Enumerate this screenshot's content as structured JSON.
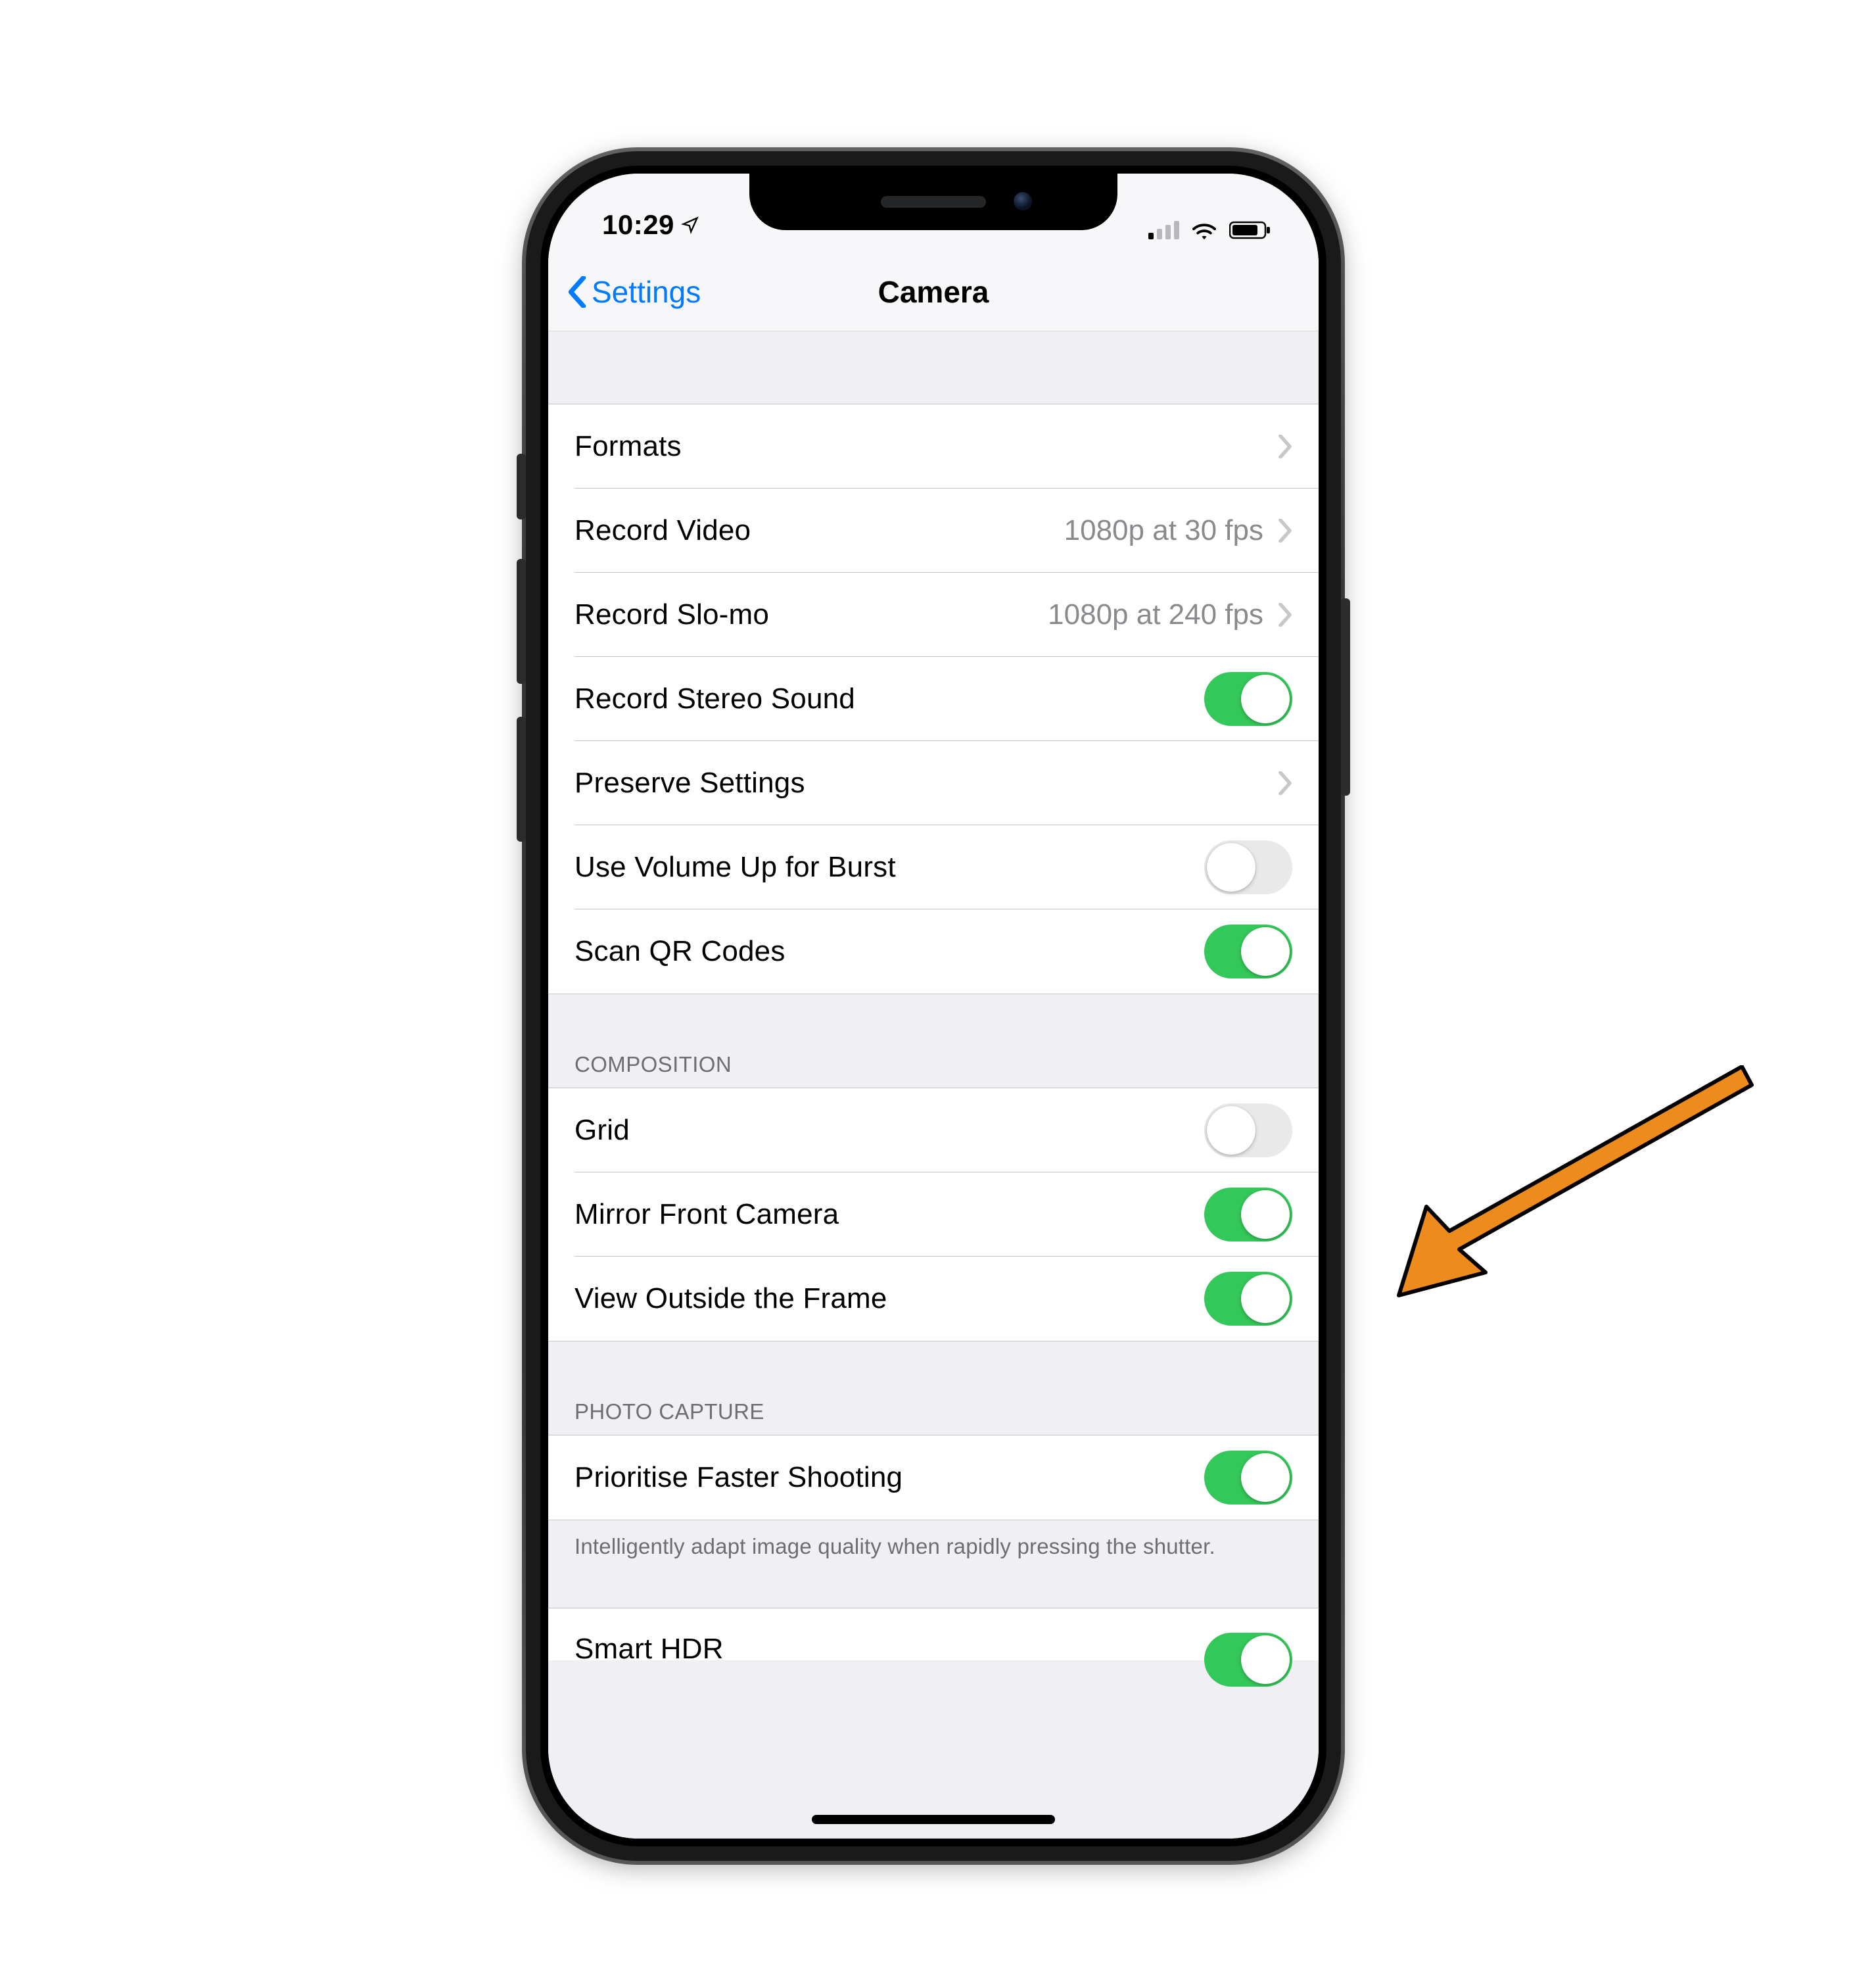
{
  "status": {
    "time": "10:29"
  },
  "nav": {
    "back": "Settings",
    "title": "Camera"
  },
  "groups": [
    {
      "header": "",
      "rows": [
        {
          "label": "Formats",
          "type": "disclosure",
          "detail": ""
        },
        {
          "label": "Record Video",
          "type": "disclosure",
          "detail": "1080p at 30 fps"
        },
        {
          "label": "Record Slo-mo",
          "type": "disclosure",
          "detail": "1080p at 240 fps"
        },
        {
          "label": "Record Stereo Sound",
          "type": "toggle",
          "on": true
        },
        {
          "label": "Preserve Settings",
          "type": "disclosure",
          "detail": ""
        },
        {
          "label": "Use Volume Up for Burst",
          "type": "toggle",
          "on": false
        },
        {
          "label": "Scan QR Codes",
          "type": "toggle",
          "on": true
        }
      ]
    },
    {
      "header": "COMPOSITION",
      "rows": [
        {
          "label": "Grid",
          "type": "toggle",
          "on": false
        },
        {
          "label": "Mirror Front Camera",
          "type": "toggle",
          "on": true
        },
        {
          "label": "View Outside the Frame",
          "type": "toggle",
          "on": true
        }
      ]
    },
    {
      "header": "PHOTO CAPTURE",
      "rows": [
        {
          "label": "Prioritise Faster Shooting",
          "type": "toggle",
          "on": true
        }
      ],
      "footer": "Intelligently adapt image quality when rapidly pressing the shutter."
    }
  ],
  "partial_row": {
    "label": "Smart HDR",
    "on": true
  }
}
